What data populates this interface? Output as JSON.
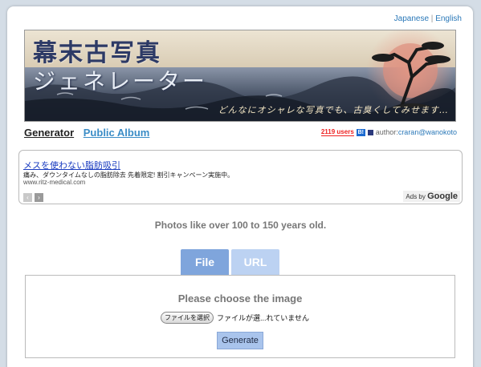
{
  "language_links": {
    "japanese": "Japanese",
    "separator": "|",
    "english": "English"
  },
  "banner": {
    "title": "幕末古写真",
    "subtitle": "ジェネレーター",
    "tagline": "どんなにオシャレな写真でも、古臭くしてみせます…"
  },
  "nav": {
    "generator": "Generator",
    "public_album": "Public Album"
  },
  "meta": {
    "users_badge": "2119 users",
    "bookmark_icon_label": "B!",
    "author_prefix": "author:",
    "author_name": "craran",
    "author_domain": "@wanokoto"
  },
  "ad": {
    "title": "メスを使わない脂肪吸引",
    "text": "痛み、ダウンタイムなしの脂肪除去 先着限定! 割引キャンペーン実施中。",
    "url": "www.ritz-medical.com",
    "prev": "‹",
    "next": "›",
    "ads_by": "Ads by",
    "ads_brand": "Google"
  },
  "tagline": "Photos like over 100 to 150 years old.",
  "tabs": [
    {
      "label": "File",
      "active": true
    },
    {
      "label": "URL",
      "active": false
    }
  ],
  "form": {
    "heading": "Please choose the image",
    "file_button": "ファイルを選択",
    "file_status": "ファイルが選...れていません",
    "generate_button": "Generate"
  },
  "colors": {
    "tab_active": "#7fa5dc",
    "tab_inactive": "#bcd2f2",
    "link": "#3a8cc6",
    "generate_button": "#a9c4ec"
  }
}
